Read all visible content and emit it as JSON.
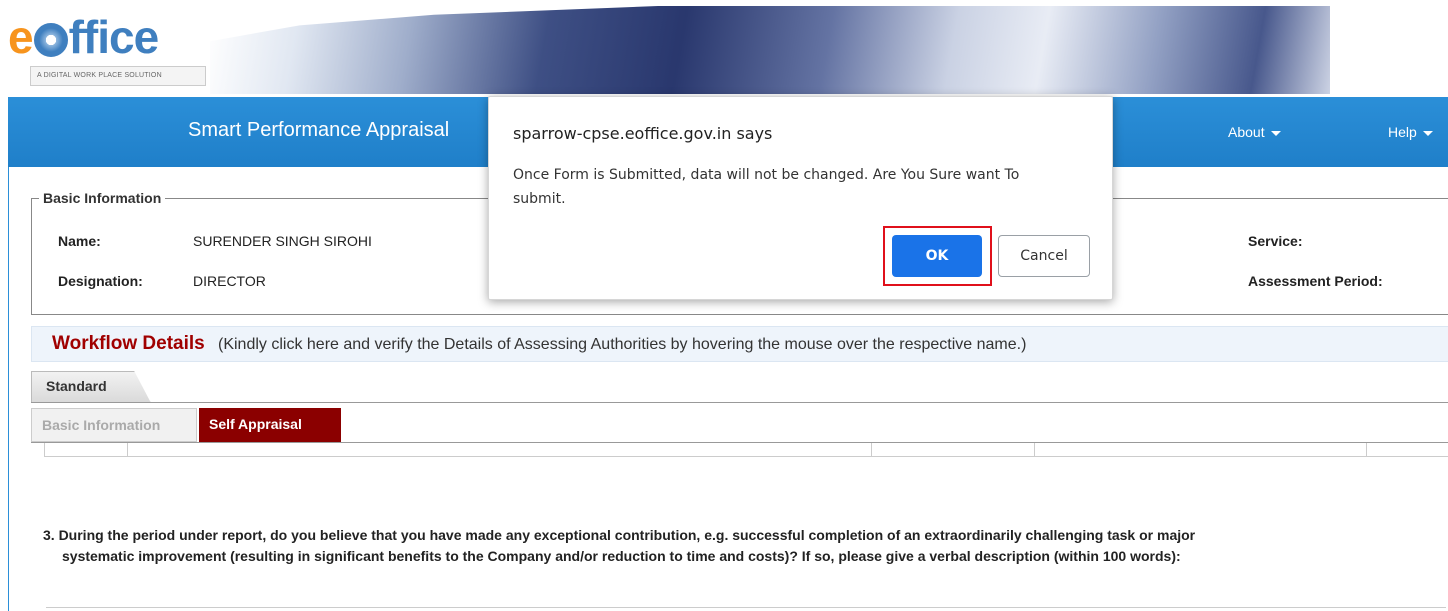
{
  "header": {
    "logo_e": "e",
    "logo_rest": "ffice",
    "tagline": "A DIGITAL WORK PLACE SOLUTION"
  },
  "navbar": {
    "title": "Smart Performance Appraisal",
    "about": "About",
    "help": "Help"
  },
  "basic_info": {
    "legend": "Basic Information",
    "name_label": "Name:",
    "name_value": "SURENDER SINGH SIROHI",
    "designation_label": "Designation:",
    "designation_value": "DIRECTOR",
    "service_label": "Service:",
    "period_label": "Assessment Period:"
  },
  "workflow": {
    "title": "Workflow Details",
    "note": "(Kindly click here and verify the Details of Assessing Authorities by hovering the mouse over the respective name.)"
  },
  "tabs": {
    "standard": "Standard",
    "basic_information": "Basic Information",
    "self_appraisal": "Self Appraisal"
  },
  "question": {
    "line1": "3. During the period under report, do you believe that you have made any exceptional contribution, e.g. successful completion of an extraordinarily challenging task or major",
    "line2": "systematic improvement (resulting in significant benefits to the Company and/or reduction to time and costs)? If so, please give a verbal description (within 100 words):"
  },
  "dialog": {
    "title": "sparrow-cpse.eoffice.gov.in says",
    "message": "Once Form is Submitted, data will not be changed. Are You Sure want To submit.",
    "ok": "OK",
    "cancel": "Cancel"
  },
  "colors": {
    "nav_blue": "#2b8fd8",
    "active_tab": "#8b0000",
    "ok_button": "#1a73e8",
    "highlight": "#e0101b"
  }
}
